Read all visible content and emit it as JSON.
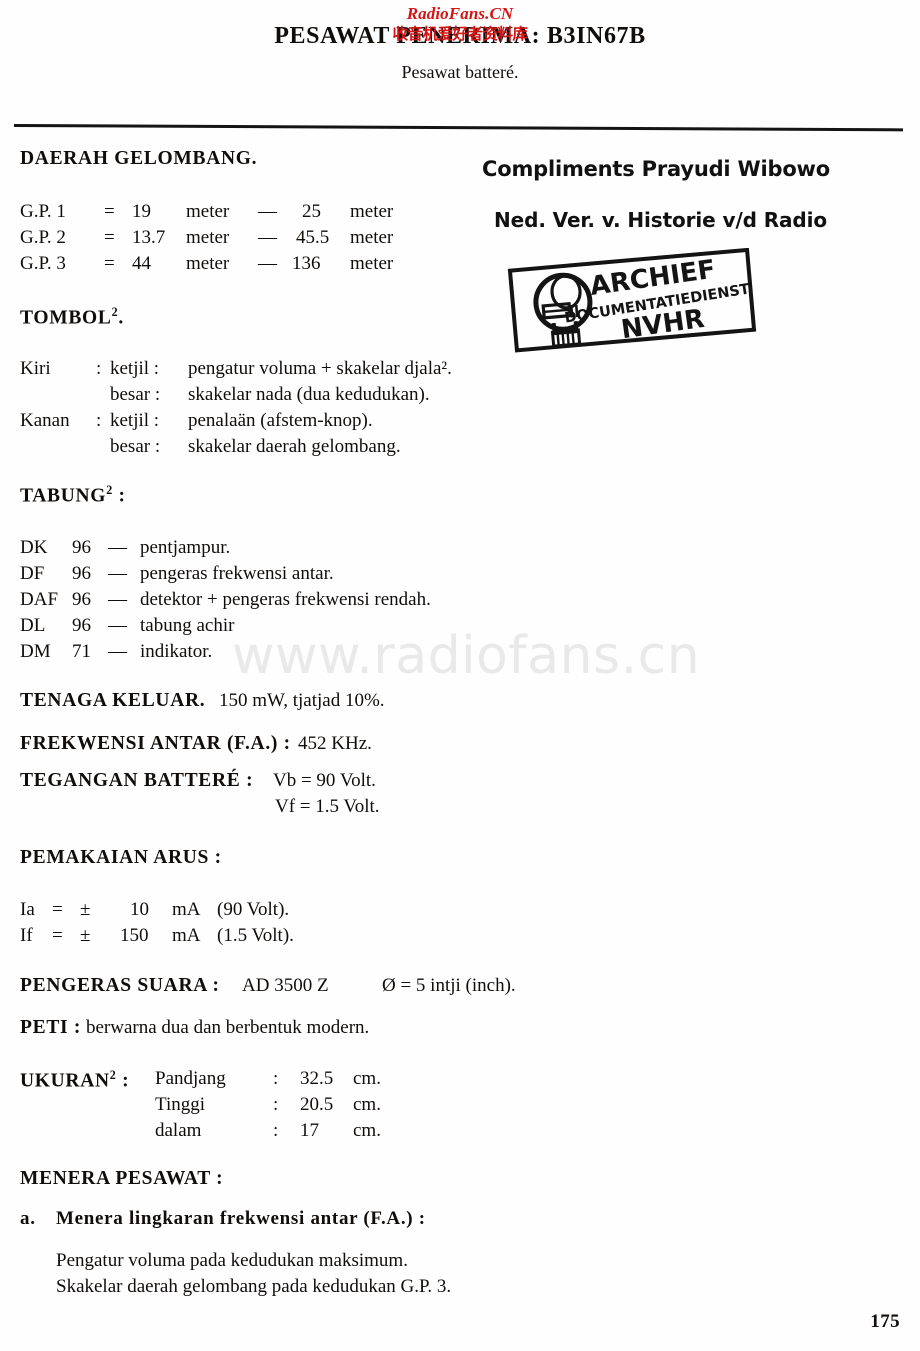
{
  "watermarks": {
    "red_latin": "RadioFans.CN",
    "red_cjk": "收音机爱好者资料库",
    "grey": "www.radiofans.cn"
  },
  "header": {
    "title": "PESAWAT PENERIMA: B3IN67B",
    "subtitle": "Pesawat batteré."
  },
  "annotations": {
    "compliments": "Compliments Prayudi Wibowo",
    "society": "Ned. Ver. v. Historie v/d Radio"
  },
  "stamp": {
    "line1": "ARCHIEF",
    "line2": "DOCUMENTATIEDIENST",
    "line3": "NVHR"
  },
  "sections": {
    "wavebands": {
      "heading": "DAERAH GELOMBANG.",
      "rows": [
        {
          "band": "G.P.  1",
          "eq": "=",
          "from": "19",
          "unit1": "meter",
          "dash": "—",
          "to": "25",
          "unit2": "meter"
        },
        {
          "band": "G.P.  2",
          "eq": "=",
          "from": "13.7",
          "unit1": "meter",
          "dash": "—",
          "to": "45.5",
          "unit2": "meter"
        },
        {
          "band": "G.P.  3",
          "eq": "=",
          "from": "44",
          "unit1": "meter",
          "dash": "—",
          "to": "136",
          "unit2": "meter"
        }
      ]
    },
    "knobs": {
      "heading": "TOMBOL",
      "heading_sup": "2",
      "heading_tail": ".",
      "rows": [
        {
          "side": "Kiri",
          "sep1": ":",
          "size": "ketjil :",
          "desc": "pengatur voluma + skakelar djala²."
        },
        {
          "side": "",
          "sep1": "",
          "size": "besar :",
          "desc": "skakelar nada (dua kedudukan)."
        },
        {
          "side": "Kanan",
          "sep1": ":",
          "size": "ketjil :",
          "desc": "penalaän (afstem-knop)."
        },
        {
          "side": "",
          "sep1": "",
          "size": "besar :",
          "desc": "skakelar daerah gelombang."
        }
      ]
    },
    "tubes": {
      "heading": "TABUNG",
      "heading_sup": "2",
      "heading_tail": " :",
      "rows": [
        {
          "type": "DK",
          "num": "96",
          "dash": "—",
          "func": "pentjampur."
        },
        {
          "type": "DF",
          "num": "96",
          "dash": "—",
          "func": "pengeras frekwensi antar."
        },
        {
          "type": "DAF",
          "num": "96",
          "dash": "—",
          "func": "detektor + pengeras frekwensi rendah."
        },
        {
          "type": "DL",
          "num": "96",
          "dash": "—",
          "func": "tabung achir"
        },
        {
          "type": "DM",
          "num": "71",
          "dash": "—",
          "func": "indikator."
        }
      ]
    },
    "output_power": {
      "label": "TENAGA KELUAR.",
      "value": "150 mW, tjatjad 10%."
    },
    "if_frequency": {
      "label": "FREKWENSI ANTAR (F.A.) :",
      "value": "452 KHz."
    },
    "battery_voltage": {
      "label": "TEGANGAN BATTERÉ :",
      "line1": "Vb  =  90  Volt.",
      "line2": "Vf   = 1.5  Volt."
    },
    "current": {
      "heading": "PEMAKAIAN ARUS :",
      "rows": [
        {
          "sym": "Ia",
          "eq": "=",
          "pm": "±",
          "val": "10",
          "unit": "mA",
          "cond": "(90  Volt)."
        },
        {
          "sym": "If",
          "eq": "=",
          "pm": "±",
          "val": "150",
          "unit": "mA",
          "cond": "(1.5 Volt)."
        }
      ]
    },
    "speaker": {
      "label": "PENGERAS SUARA :",
      "model": "AD 3500 Z",
      "diameter": "Ø = 5 intji (inch)."
    },
    "cabinet": {
      "label": "PETI :",
      "value": "berwarna dua dan berbentuk modern."
    },
    "dimensions": {
      "label": "UKURAN",
      "label_sup": "2",
      "label_tail": " :",
      "rows": [
        {
          "name": "Pandjang",
          "sep": ":",
          "value": "32.5",
          "unit": "cm."
        },
        {
          "name": "Tinggi",
          "sep": ":",
          "value": "20.5",
          "unit": "cm."
        },
        {
          "name": "dalam",
          "sep": ":",
          "value": "17",
          "unit": "cm."
        }
      ]
    },
    "alignment": {
      "heading": "MENERA PESAWAT :",
      "item_label": "a.",
      "item_text": "Menera lingkaran frekwensi antar (F.A.) :",
      "body_line1": "Pengatur voluma pada kedudukan maksimum.",
      "body_line2": "Skakelar daerah gelombang pada kedudukan G.P. 3."
    }
  },
  "page_number": "175"
}
